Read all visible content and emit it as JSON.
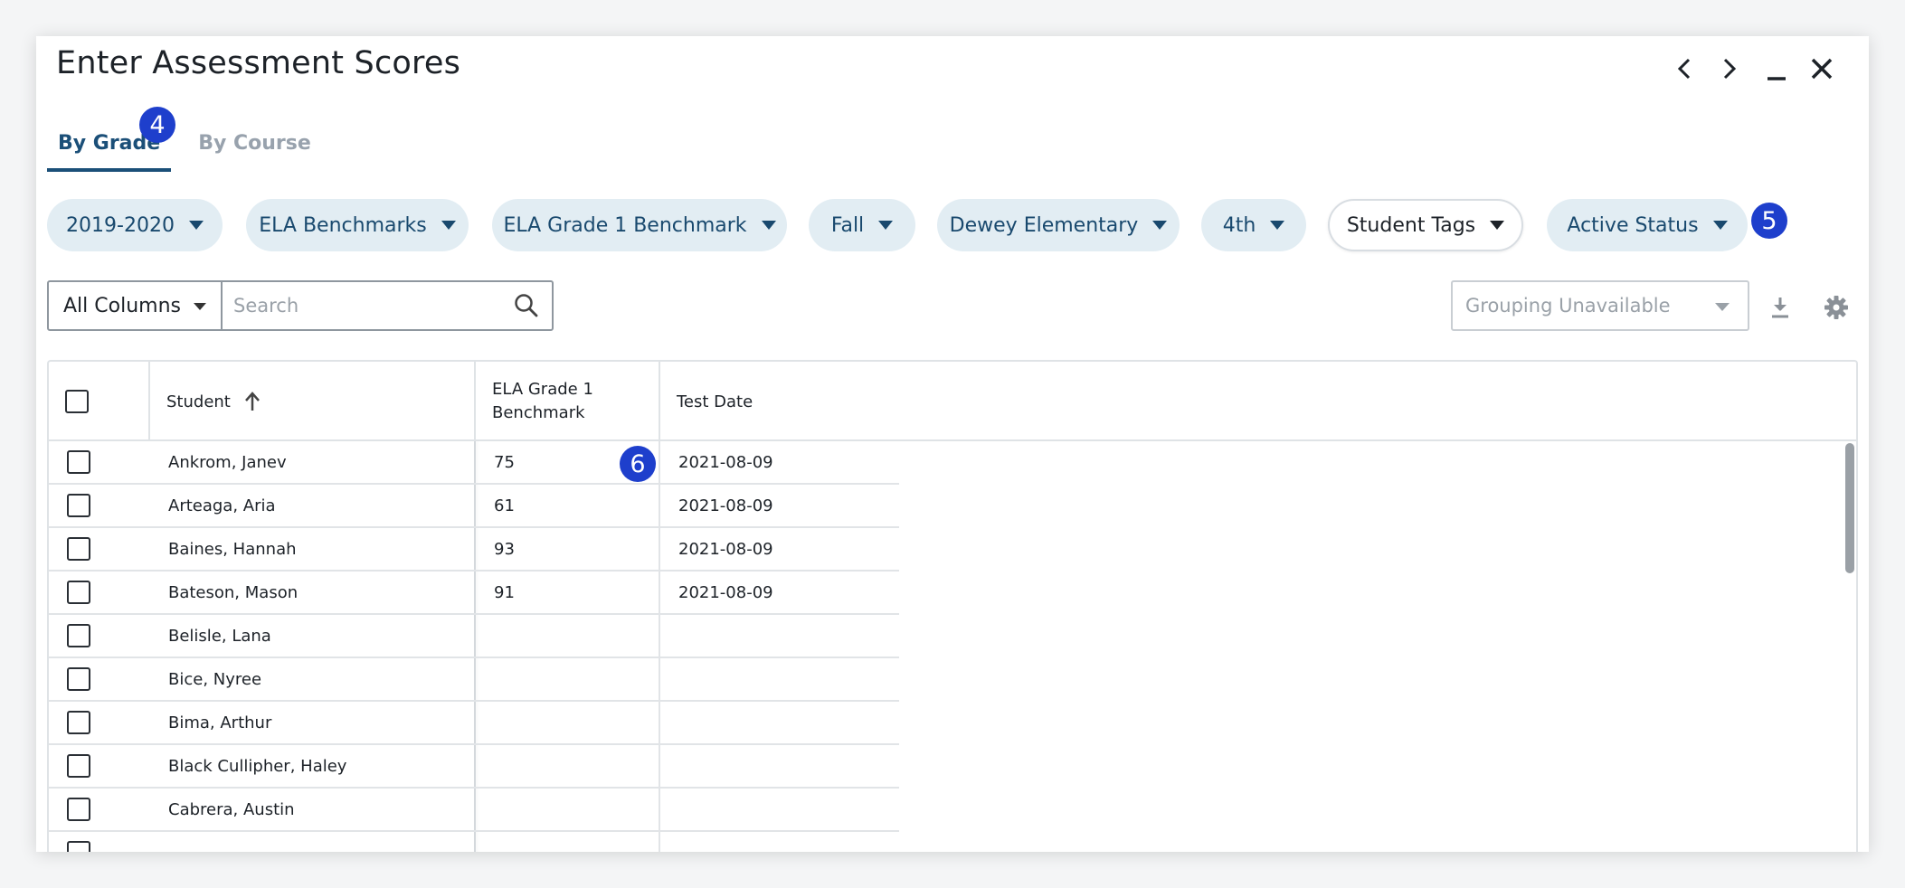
{
  "window": {
    "title": "Enter Assessment Scores"
  },
  "tabs": [
    {
      "label": "By Grade",
      "active": true
    },
    {
      "label": "By Course",
      "active": false
    }
  ],
  "badges": {
    "tabs": "4",
    "filters": "5",
    "score": "6"
  },
  "filters": [
    {
      "label": "2019-2020"
    },
    {
      "label": "ELA Benchmarks"
    },
    {
      "label": "ELA Grade 1 Benchmark"
    },
    {
      "label": "Fall"
    },
    {
      "label": "Dewey Elementary"
    },
    {
      "label": "4th"
    },
    {
      "label": "Student Tags"
    },
    {
      "label": "Active Status"
    }
  ],
  "toolbar": {
    "column_select": "All Columns",
    "search_placeholder": "Search",
    "grouping_placeholder": "Grouping Unavailable"
  },
  "table": {
    "headers": {
      "student": "Student",
      "benchmark_line1": "ELA Grade 1",
      "benchmark_line2": "Benchmark",
      "test_date": "Test Date"
    },
    "rows": [
      {
        "student": "Ankrom, Janev",
        "score": "75",
        "date": "2021-08-09"
      },
      {
        "student": "Arteaga, Aria",
        "score": "61",
        "date": "2021-08-09"
      },
      {
        "student": "Baines, Hannah",
        "score": "93",
        "date": "2021-08-09"
      },
      {
        "student": "Bateson, Mason",
        "score": "91",
        "date": "2021-08-09"
      },
      {
        "student": "Belisle, Lana",
        "score": "",
        "date": ""
      },
      {
        "student": "Bice, Nyree",
        "score": "",
        "date": ""
      },
      {
        "student": "Bima, Arthur",
        "score": "",
        "date": ""
      },
      {
        "student": "Black Cullipher, Haley",
        "score": "",
        "date": ""
      },
      {
        "student": "Cabrera, Austin",
        "score": "",
        "date": ""
      }
    ]
  },
  "colors": {
    "accent": "#1b4f78",
    "badge": "#1e3fcc",
    "chip_bg": "#e2edf3"
  },
  "icons": {
    "prev": "chevron-left-icon",
    "next": "chevron-right-icon",
    "minimize": "minimize-icon",
    "close": "close-icon",
    "search": "search-icon",
    "download": "download-icon",
    "settings": "gear-icon",
    "sort": "arrow-up-icon"
  }
}
